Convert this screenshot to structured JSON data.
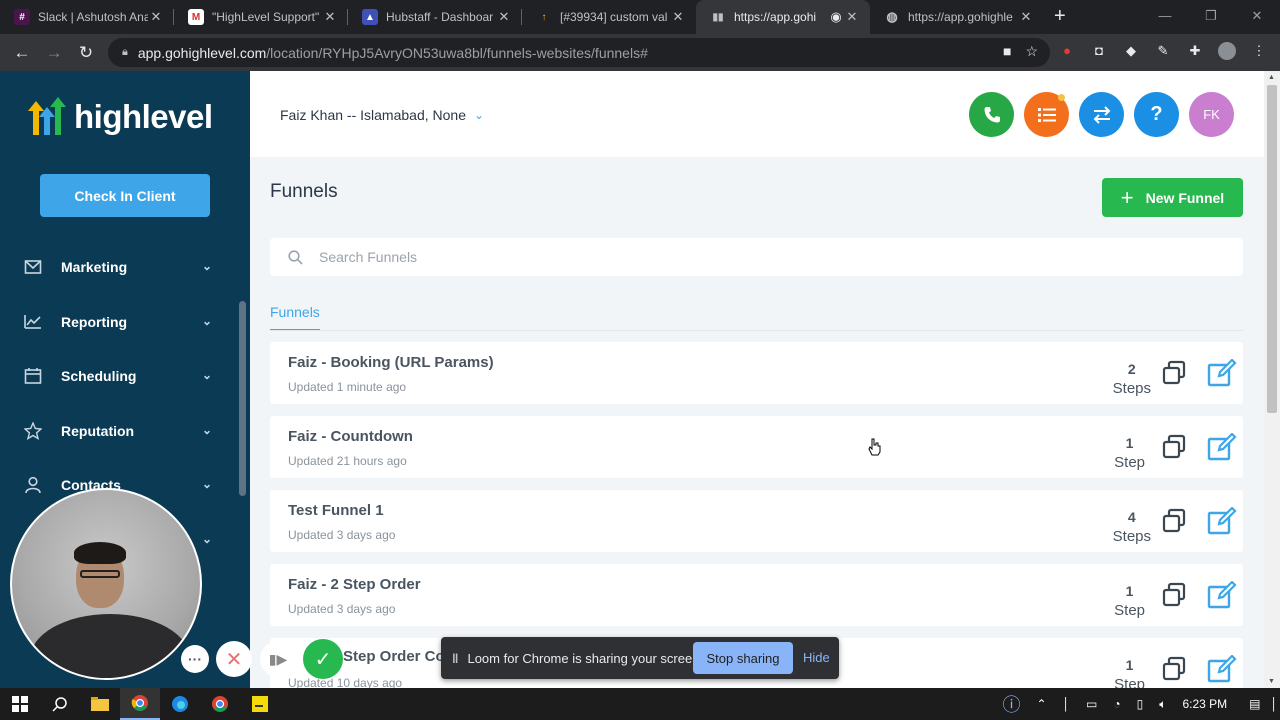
{
  "browser": {
    "tabs": [
      {
        "title": "Slack | Ashutosh Ana",
        "favicon_color": "#4a154b",
        "active": false
      },
      {
        "title": "\"HighLevel Support\"",
        "favicon_color": "#d93025",
        "active": false
      },
      {
        "title": "Hubstaff - Dashboar",
        "favicon_color": "#3f51b5",
        "active": false
      },
      {
        "title": "[#39934] custom val",
        "favicon_color": "#f5b800",
        "active": false
      },
      {
        "title": "https://app.gohi",
        "favicon_color": "#5f6368",
        "active": true
      },
      {
        "title": "https://app.gohighle",
        "favicon_color": "#8ab4f8",
        "active": false
      }
    ],
    "url_host": "app.gohighlevel.com",
    "url_path": "/location/RYHpJ5AvryON53uwa8bl/funnels-websites/funnels#"
  },
  "sidebar": {
    "logo_text": "highlevel",
    "checkin_label": "Check In Client",
    "items": [
      {
        "label": "Marketing",
        "icon": "mail-icon"
      },
      {
        "label": "Reporting",
        "icon": "chart-icon"
      },
      {
        "label": "Scheduling",
        "icon": "calendar-icon"
      },
      {
        "label": "Reputation",
        "icon": "star-icon"
      },
      {
        "label": "Contacts",
        "icon": "user-icon"
      }
    ]
  },
  "header": {
    "location": "Faiz Khan -- Islamabad, None",
    "avatar_initials": "FK",
    "colors": {
      "phone": "#27a745",
      "tasks": "#f46f1b",
      "switch": "#1a8fe3",
      "help": "#1a8fe3"
    }
  },
  "page": {
    "title": "Funnels",
    "new_button": "New Funnel",
    "search_placeholder": "Search Funnels",
    "subtab": "Funnels"
  },
  "funnels": [
    {
      "name": "Faiz - Booking (URL Params)",
      "updated": "Updated 1 minute ago",
      "count": "2",
      "unit": "Steps"
    },
    {
      "name": "Faiz - Countdown",
      "updated": "Updated 21 hours ago",
      "count": "1",
      "unit": "Step"
    },
    {
      "name": "Test Funnel 1",
      "updated": "Updated 3 days ago",
      "count": "4",
      "unit": "Steps"
    },
    {
      "name": "Faiz - 2 Step Order",
      "updated": "Updated 3 days ago",
      "count": "1",
      "unit": "Step"
    },
    {
      "name": "",
      "updated": "Updated 10 days ago",
      "count": "1",
      "unit": "Step"
    }
  ],
  "obscured_row_text": "Step Order Co",
  "loom": {
    "share_text": "Loom for Chrome is sharing your screen.",
    "stop_label": "Stop sharing",
    "hide_label": "Hide"
  },
  "taskbar": {
    "time": "6:23 PM"
  }
}
